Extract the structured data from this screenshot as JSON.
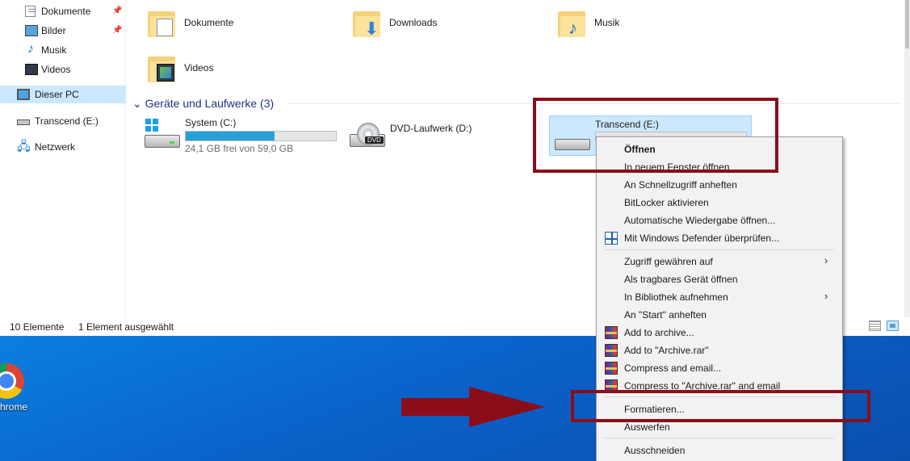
{
  "sidebar": {
    "items": [
      {
        "label": "Dokumente",
        "pinned": true,
        "icon": "documents-icon"
      },
      {
        "label": "Bilder",
        "pinned": true,
        "icon": "pictures-icon"
      },
      {
        "label": "Musik",
        "pinned": false,
        "icon": "music-icon"
      },
      {
        "label": "Videos",
        "pinned": false,
        "icon": "videos-icon"
      },
      {
        "label": "Dieser PC",
        "selected": true,
        "icon": "this-pc-icon"
      },
      {
        "label": "Transcend (E:)",
        "icon": "usb-drive-icon"
      },
      {
        "label": "Netzwerk",
        "icon": "network-icon"
      }
    ],
    "pin_glyph": "📌"
  },
  "folders": [
    {
      "label": "Dokumente",
      "icon": "documents-folder-icon"
    },
    {
      "label": "Downloads",
      "icon": "downloads-folder-icon"
    },
    {
      "label": "Musik",
      "icon": "music-folder-icon"
    },
    {
      "label": "Videos",
      "icon": "videos-folder-icon"
    }
  ],
  "devices_group": {
    "header": "Geräte und Laufwerke (3)",
    "chevron": "⌄"
  },
  "drives": [
    {
      "label": "System (C:)",
      "free_text": "24,1 GB frei von 59,0 GB",
      "used_fraction": 0.59
    },
    {
      "label": "DVD-Laufwerk (D:)",
      "badge": "DVD"
    },
    {
      "label": "Transcend (E:)",
      "selected": true
    }
  ],
  "status": {
    "count": "10 Elemente",
    "selection": "1 Element ausgewählt"
  },
  "desktop": {
    "shortcut_label": "hrome"
  },
  "context_menu": {
    "items": [
      {
        "label": "Öffnen",
        "bold": true
      },
      {
        "label": "In neuem Fenster öffnen"
      },
      {
        "label": "An Schnellzugriff anheften"
      },
      {
        "label": "BitLocker aktivieren"
      },
      {
        "label": "Automatische Wiedergabe öffnen..."
      },
      {
        "label": "Mit Windows Defender überprüfen...",
        "icon": "windows-defender-icon"
      },
      {
        "label": "Zugriff gewähren auf",
        "submenu": true
      },
      {
        "label": "Als tragbares Gerät öffnen"
      },
      {
        "label": "In Bibliothek aufnehmen",
        "submenu": true
      },
      {
        "label": "An \"Start\" anheften"
      },
      {
        "label": "Add to archive...",
        "icon": "winrar-icon"
      },
      {
        "label": "Add to \"Archive.rar\"",
        "icon": "winrar-icon"
      },
      {
        "label": "Compress and email...",
        "icon": "winrar-icon"
      },
      {
        "label": "Compress to \"Archive.rar\" and email",
        "icon": "winrar-icon"
      },
      {
        "label": "Formatieren..."
      },
      {
        "label": "Auswerfen"
      },
      {
        "label": "Ausschneiden"
      }
    ],
    "submenu_arrow": "›"
  },
  "colors": {
    "selection": "#cce8ff",
    "annotation": "#8b0d1a",
    "progress": "#26a0da",
    "group_header": "#1e3287"
  }
}
